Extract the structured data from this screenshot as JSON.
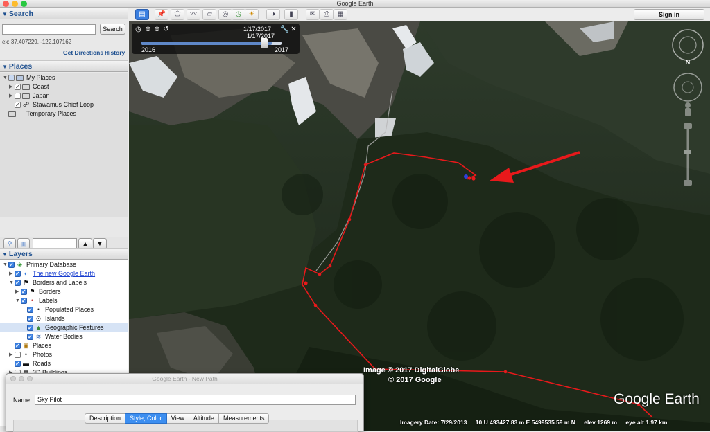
{
  "window": {
    "title": "Google Earth"
  },
  "toolbar": {
    "signin_label": "Sign in"
  },
  "search": {
    "header": "Search",
    "input_value": "",
    "button_label": "Search",
    "example_text": "ex: 37.407229, -122.107162",
    "get_directions": "Get Directions",
    "history": "History"
  },
  "places": {
    "header": "Places",
    "items": [
      {
        "label": "My Places"
      },
      {
        "label": "Coast"
      },
      {
        "label": "Japan"
      },
      {
        "label": "Stawamus Chief Loop"
      },
      {
        "label": "Temporary Places"
      }
    ]
  },
  "layers": {
    "header": "Layers",
    "items": [
      {
        "label": "Primary Database"
      },
      {
        "label": "The new Google Earth"
      },
      {
        "label": "Borders and Labels"
      },
      {
        "label": "Borders"
      },
      {
        "label": "Labels"
      },
      {
        "label": "Populated Places"
      },
      {
        "label": "Islands"
      },
      {
        "label": "Geographic Features"
      },
      {
        "label": "Water Bodies"
      },
      {
        "label": "Places"
      },
      {
        "label": "Photos"
      },
      {
        "label": "Roads"
      },
      {
        "label": "3D Buildings"
      }
    ]
  },
  "time_slider": {
    "date_start": "1/17/2017",
    "date_end": "1/17/2017",
    "year_start": "2016",
    "year_end": "2017",
    "position": 0.93
  },
  "map": {
    "credit_line1": "Image © 2017 DigitalGlobe",
    "credit_line2": "© 2017 Google",
    "logo": "Google Earth",
    "status": {
      "imagery_date": "Imagery Date: 7/29/2013",
      "coords": "10 U 493427.83 m E 5499535.59 m N",
      "elev": "elev  1269 m",
      "eye_alt": "eye alt  1.97 km"
    },
    "track_color": "#e8191b",
    "compass_north": "N"
  },
  "dialog": {
    "title": "Google Earth - New Path",
    "name_label": "Name:",
    "name_value": "Sky Pilot",
    "tabs": [
      {
        "label": "Description",
        "active": false
      },
      {
        "label": "Style, Color",
        "active": true
      },
      {
        "label": "View",
        "active": false
      },
      {
        "label": "Altitude",
        "active": false
      },
      {
        "label": "Measurements",
        "active": false
      }
    ]
  }
}
